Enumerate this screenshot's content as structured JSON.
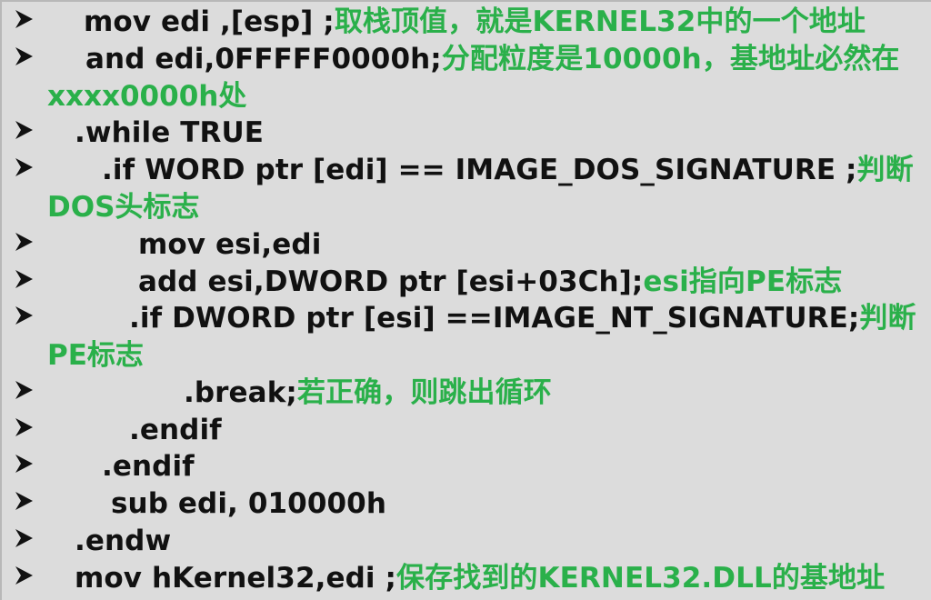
{
  "lines": [
    {
      "code": "mov edi ,[esp] ;",
      "comment": "取栈顶值，就是KERNEL32中的一个地址"
    },
    {
      "code": "and edi,0FFFFF0000h;",
      "comment": "分配粒度是10000h，基地址必然在"
    },
    {
      "cont": "xxxx0000h处"
    },
    {
      "code": ".while TRUE",
      "comment": ""
    },
    {
      "code": ".if WORD ptr [edi] == IMAGE_DOS_SIGNATURE  ;",
      "comment": "判断"
    },
    {
      "cont": "DOS头标志"
    },
    {
      "code": "mov esi,edi",
      "comment": ""
    },
    {
      "code": "add esi,DWORD ptr [esi+03Ch];",
      "comment": "esi指向PE标志"
    },
    {
      "code": ".if DWORD ptr [esi] ==IMAGE_NT_SIGNATURE;",
      "comment": "判断"
    },
    {
      "cont": "PE标志"
    },
    {
      "code": ".break;",
      "comment": "若正确，则跳出循环"
    },
    {
      "code": ".endif",
      "comment": ""
    },
    {
      "code": ".endif",
      "comment": ""
    },
    {
      "code": "sub edi, 010000h",
      "comment": ""
    },
    {
      "code": ".endw",
      "comment": ""
    },
    {
      "code": "mov hKernel32,edi ;",
      "comment": "保存找到的KERNEL32.DLL的基地址"
    }
  ]
}
